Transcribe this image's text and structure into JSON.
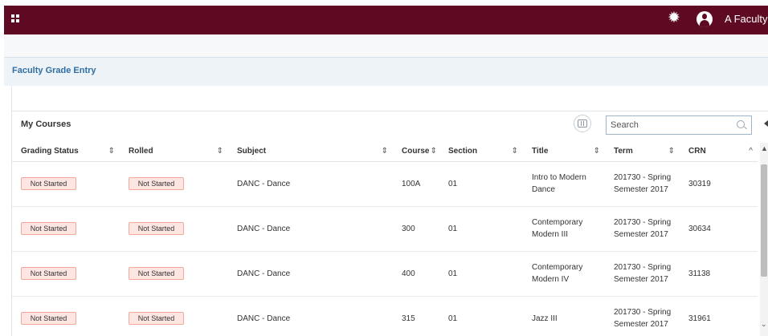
{
  "header": {
    "user_name": "A Faculty",
    "bar_color": "#5e0a22",
    "icons": [
      "apps-grid-icon",
      "gear-icon",
      "user-avatar-icon"
    ]
  },
  "page": {
    "title": "Faculty Grade Entry"
  },
  "courses": {
    "title": "My Courses",
    "search_placeholder": "Search",
    "columns": [
      {
        "label": "Grading Status",
        "sort": "⇕"
      },
      {
        "label": "Rolled",
        "sort": "⇕"
      },
      {
        "label": "Subject",
        "sort": "⇕"
      },
      {
        "label": "Course",
        "sort": "⇕"
      },
      {
        "label": "Section",
        "sort": "⇕"
      },
      {
        "label": "Title",
        "sort": "⇕"
      },
      {
        "label": "Term",
        "sort": "⇕"
      },
      {
        "label": "CRN",
        "sort": "^"
      }
    ],
    "rows": [
      {
        "grading_status": "Not Started",
        "rolled": "Not Started",
        "subject": "DANC - Dance",
        "course": "100A",
        "section": "01",
        "title": "Intro to Modern Dance",
        "term": "201730 - Spring Semester 2017",
        "crn": "30319"
      },
      {
        "grading_status": "Not Started",
        "rolled": "Not Started",
        "subject": "DANC - Dance",
        "course": "300",
        "section": "01",
        "title": "Contemporary Modern III",
        "term": "201730 - Spring Semester 2017",
        "crn": "30634"
      },
      {
        "grading_status": "Not Started",
        "rolled": "Not Started",
        "subject": "DANC - Dance",
        "course": "400",
        "section": "01",
        "title": "Contemporary Modern IV",
        "term": "201730 - Spring Semester 2017",
        "crn": "31138"
      },
      {
        "grading_status": "Not Started",
        "rolled": "Not Started",
        "subject": "DANC - Dance",
        "course": "315",
        "section": "01",
        "title": "Jazz III",
        "term": "201730 - Spring Semester 2017",
        "crn": "31961"
      }
    ]
  }
}
